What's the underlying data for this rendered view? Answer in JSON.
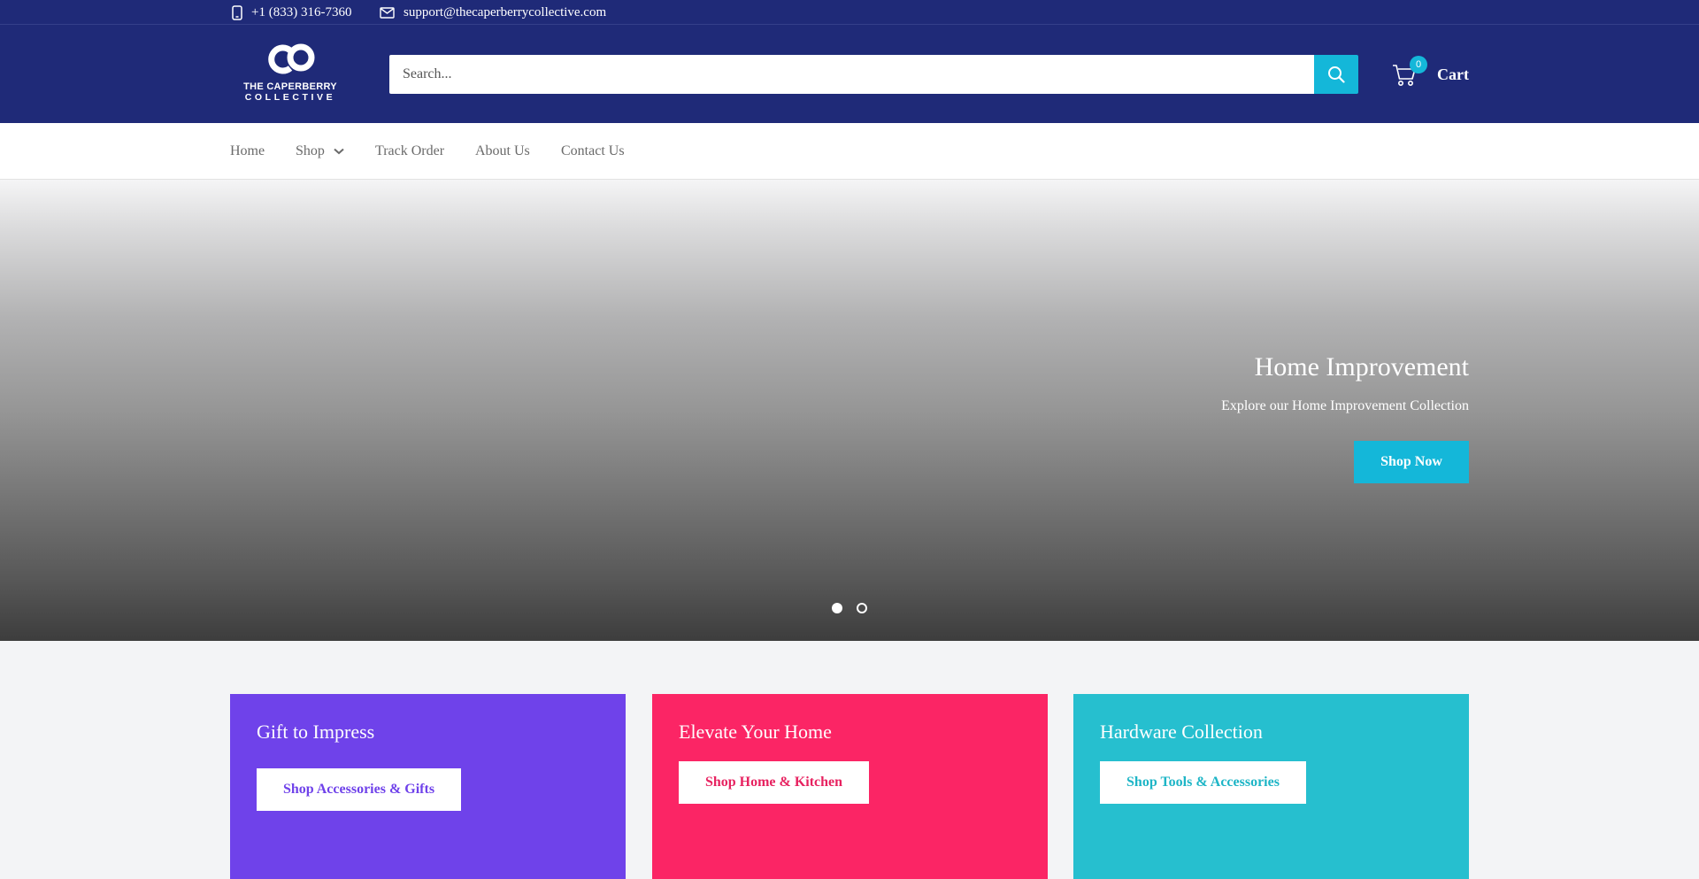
{
  "topbar": {
    "phone": "+1 (833) 316-7360",
    "email": "support@thecaperberrycollective.com"
  },
  "header": {
    "logo": {
      "line1": "THE CAPERBERRY",
      "line2": "COLLECTIVE"
    },
    "search": {
      "placeholder": "Search...",
      "value": ""
    },
    "cart": {
      "count": "0",
      "label": "Cart"
    }
  },
  "nav": {
    "items": [
      {
        "label": "Home"
      },
      {
        "label": "Shop"
      },
      {
        "label": "Track Order"
      },
      {
        "label": "About Us"
      },
      {
        "label": "Contact Us"
      }
    ]
  },
  "hero": {
    "title": "Home Improvement",
    "subtitle": "Explore our Home Improvement Collection",
    "button": "Shop Now",
    "slides": 2,
    "active_slide": 1
  },
  "cards": [
    {
      "title": "Gift to Impress",
      "button": "Shop Accessories & Gifts",
      "bg": "#6f42ea",
      "accent": "#6f42ea"
    },
    {
      "title": "Elevate Your Home",
      "button": "Shop Home & Kitchen",
      "bg": "#fb2565",
      "accent": "#e72260"
    },
    {
      "title": "Hardware Collection",
      "button": "Shop Tools & Accessories",
      "bg": "#26bfcf",
      "accent": "#1db5c6"
    }
  ],
  "colors": {
    "header_bg": "#1f2a78",
    "accent": "#14b7d9",
    "nav_text": "#6a6a6a",
    "page_bg": "#f3f4f6"
  }
}
